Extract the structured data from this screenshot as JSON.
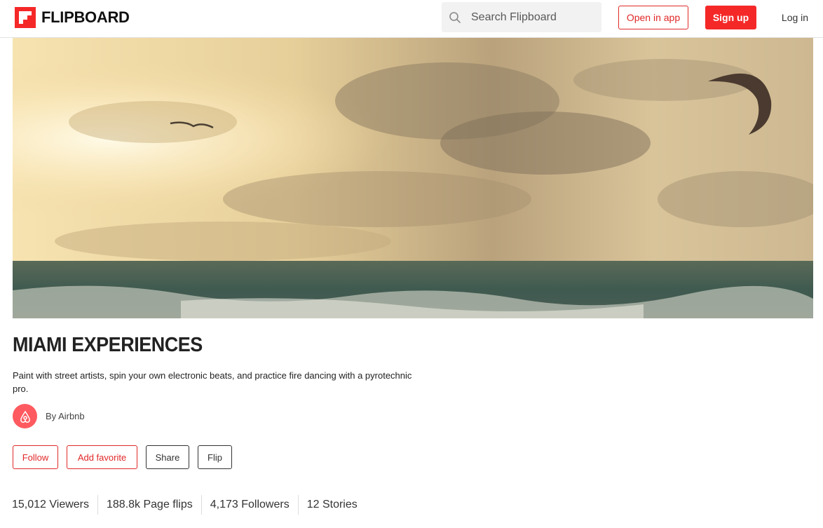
{
  "header": {
    "logo_text": "FLIPBOARD",
    "search_placeholder": "Search Flipboard",
    "open_in_app_label": "Open in app",
    "signup_label": "Sign up",
    "login_label": "Log in"
  },
  "magazine": {
    "title": "MIAMI EXPERIENCES",
    "description": "Paint with street artists, spin your own electronic beats, and practice fire dancing with a pyrotechnic pro.",
    "author": "By Airbnb"
  },
  "actions": {
    "follow_label": "Follow",
    "favorite_label": "Add favorite",
    "share_label": "Share",
    "flip_label": "Flip"
  },
  "stats": [
    "15,012 Viewers",
    "188.8k Page flips",
    "4,173 Followers",
    "12 Stories"
  ],
  "colors": {
    "brand_red": "#f52828",
    "airbnb": "#ff5a5f"
  }
}
